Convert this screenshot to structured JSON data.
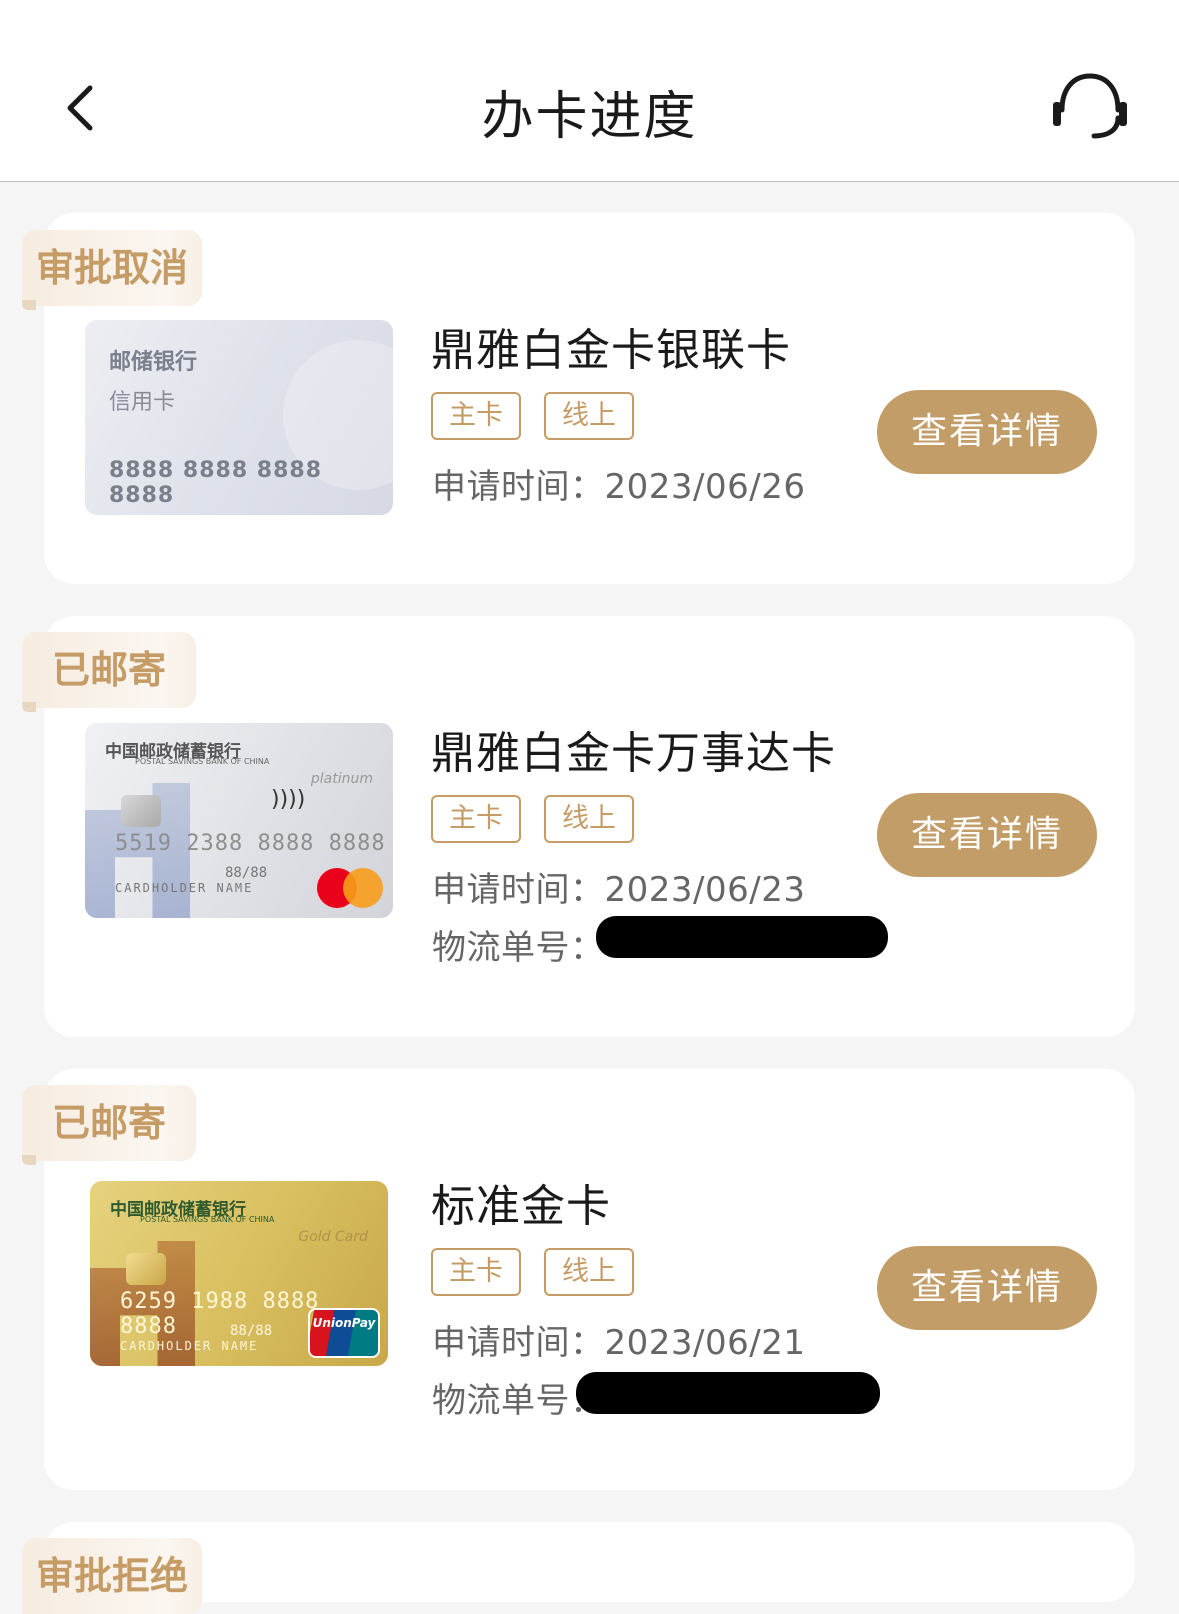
{
  "header": {
    "title": "办卡进度",
    "back_icon": "chevron-left-icon",
    "service_icon": "headset-icon"
  },
  "colors": {
    "accent": "#c29d68",
    "badge_text": "#c59b66",
    "background": "#f5f5f5"
  },
  "labels": {
    "apply_time": "申请时间：",
    "tracking_no": "物流单号："
  },
  "cards": [
    {
      "status": "审批取消",
      "name": "鼎雅白金卡银联卡",
      "tags": [
        "主卡",
        "线上"
      ],
      "apply_date": "2023/06/26",
      "button": "查看详情",
      "thumb": {
        "bank": "邮储银行",
        "sub": "信用卡",
        "number": "8888 8888 8888 8888"
      }
    },
    {
      "status": "已邮寄",
      "name": "鼎雅白金卡万事达卡",
      "tags": [
        "主卡",
        "线上"
      ],
      "apply_date": "2023/06/23",
      "button": "查看详情",
      "thumb": {
        "bank": "中国邮政储蓄银行",
        "bank_en": "POSTAL SAVINGS BANK OF CHINA",
        "grade": "platinum",
        "number": "5519 2388 8888 8888",
        "holder": "CARDHOLDER NAME",
        "expiry": "88/88",
        "contactless": "))))"
      }
    },
    {
      "status": "已邮寄",
      "name": "标准金卡",
      "tags": [
        "主卡",
        "线上"
      ],
      "apply_date": "2023/06/21",
      "button": "查看详情",
      "thumb": {
        "bank": "中国邮政储蓄银行",
        "bank_en": "POSTAL SAVINGS BANK OF CHINA",
        "grade": "Gold Card",
        "number": "6259 1988 8888 8888",
        "holder": "CARDHOLDER NAME",
        "expiry": "88/88",
        "network": "UnionPay"
      }
    },
    {
      "status": "审批拒绝"
    }
  ]
}
